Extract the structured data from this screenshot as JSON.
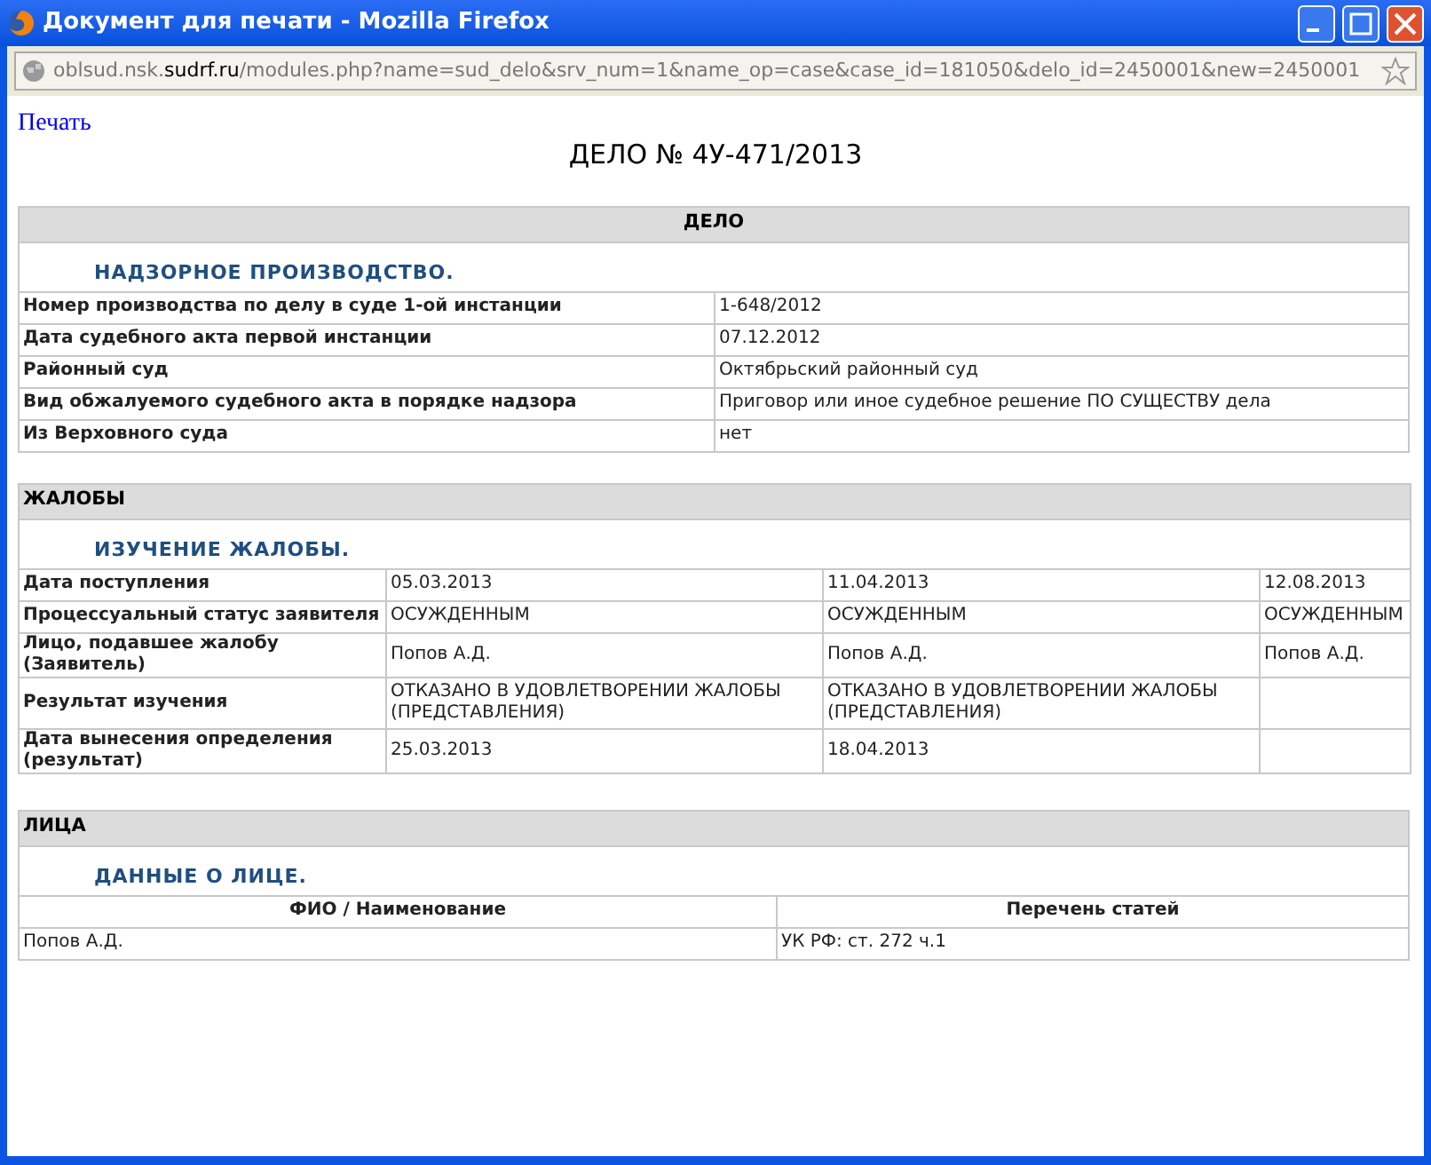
{
  "window": {
    "title": "Документ для печати - Mozilla Firefox"
  },
  "address_bar": {
    "url_start": "oblsud.nsk.",
    "url_domain": "sudrf.ru",
    "url_rest": "/modules.php?name=sud_delo&srv_num=1&name_op=case&case_id=181050&delo_id=2450001&new=2450001"
  },
  "print_link": "Печать",
  "heading": "ДЕЛО № 4У-471/2013",
  "case": {
    "header": "ДЕЛО",
    "subtitle": "НАДЗОРНОЕ ПРОИЗВОДСТВО.",
    "rows": [
      {
        "label": "Номер производства по делу в суде 1-ой инстанции",
        "value": "1-648/2012"
      },
      {
        "label": "Дата судебного акта первой инстанции",
        "value": "07.12.2012"
      },
      {
        "label": "Районный суд",
        "value": "Октябрьский районный суд"
      },
      {
        "label": "Вид обжалуемого судебного акта в порядке надзора",
        "value": "Приговор или иное судебное решение ПО СУЩЕСТВУ дела"
      },
      {
        "label": "Из Верховного суда",
        "value": "нет"
      }
    ]
  },
  "complaints": {
    "header": "ЖАЛОБЫ",
    "subtitle": "ИЗУЧЕНИЕ ЖАЛОБЫ.",
    "rows": [
      {
        "label": "Дата поступления",
        "cells": [
          "05.03.2013",
          "11.04.2013",
          "12.08.2013"
        ]
      },
      {
        "label": "Процессуальный статус заявителя",
        "cells": [
          "ОСУЖДЕННЫМ",
          "ОСУЖДЕННЫМ",
          "ОСУЖДЕННЫМ"
        ]
      },
      {
        "label": "Лицо, подавшее жалобу (Заявитель)",
        "cells": [
          "Попов А.Д.",
          "Попов А.Д.",
          "Попов А.Д."
        ]
      },
      {
        "label": "Результат изучения",
        "cells": [
          "ОТКАЗАНО В УДОВЛЕТВОРЕНИИ ЖАЛОБЫ (ПРЕДСТАВЛЕНИЯ)",
          "ОТКАЗАНО В УДОВЛЕТВОРЕНИИ ЖАЛОБЫ (ПРЕДСТАВЛЕНИЯ)"
        ]
      },
      {
        "label": "Дата вынесения определения (результат)",
        "cells": [
          "25.03.2013",
          "18.04.2013"
        ]
      }
    ]
  },
  "persons": {
    "header": "ЛИЦА",
    "subtitle": "ДАННЫЕ О ЛИЦЕ.",
    "columns": [
      "ФИО / Наименование",
      "Перечень статей"
    ],
    "rows": [
      [
        "Попов А.Д.",
        "УК РФ: ст. 272 ч.1"
      ]
    ]
  }
}
